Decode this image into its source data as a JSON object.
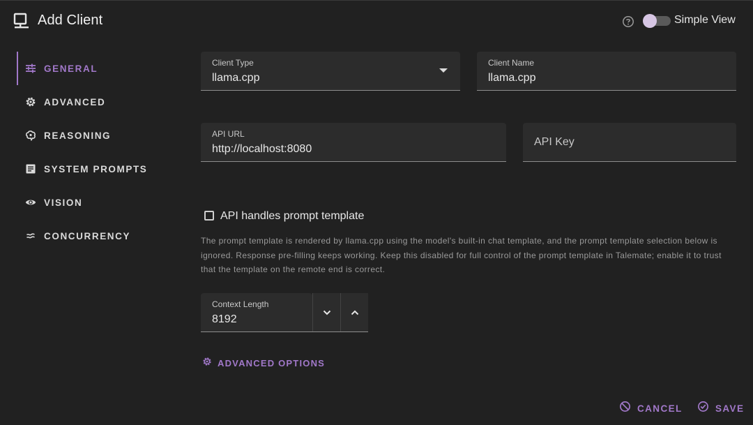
{
  "header": {
    "title": "Add Client",
    "title_icon": "monitor-icon",
    "help_icon": "help-circle-icon",
    "simple_view_label": "Simple View",
    "simple_view_on": false
  },
  "nav": {
    "items": [
      {
        "label": "GENERAL",
        "icon": "tune-icon",
        "active": true
      },
      {
        "label": "ADVANCED",
        "icon": "gear-icon",
        "active": false
      },
      {
        "label": "REASONING",
        "icon": "brain-icon",
        "active": false
      },
      {
        "label": "SYSTEM PROMPTS",
        "icon": "document-icon",
        "active": false
      },
      {
        "label": "VISION",
        "icon": "eye-icon",
        "active": false
      },
      {
        "label": "CONCURRENCY",
        "icon": "approx-equal-icon",
        "active": false
      }
    ]
  },
  "form": {
    "client_type": {
      "label": "Client Type",
      "value": "llama.cpp"
    },
    "client_name": {
      "label": "Client Name",
      "value": "llama.cpp"
    },
    "api_url": {
      "label": "API URL",
      "value": "http://localhost:8080"
    },
    "api_key": {
      "placeholder": "API Key",
      "value": ""
    },
    "api_template": {
      "label": "API handles prompt template",
      "checked": false,
      "hint": "The prompt template is rendered by llama.cpp using the model's built-in chat template, and the prompt template selection below is ignored. Response pre-filling keeps working. Keep this disabled for full control of the prompt template in Talemate; enable it to trust that the template on the remote end is correct."
    },
    "context_length": {
      "label": "Context Length",
      "value": "8192"
    },
    "advanced_options_label": "ADVANCED OPTIONS"
  },
  "actions": {
    "cancel_label": "CANCEL",
    "save_label": "SAVE"
  },
  "colors": {
    "accent": "#a178c9",
    "background": "#212121",
    "field": "#2c2c2c"
  }
}
